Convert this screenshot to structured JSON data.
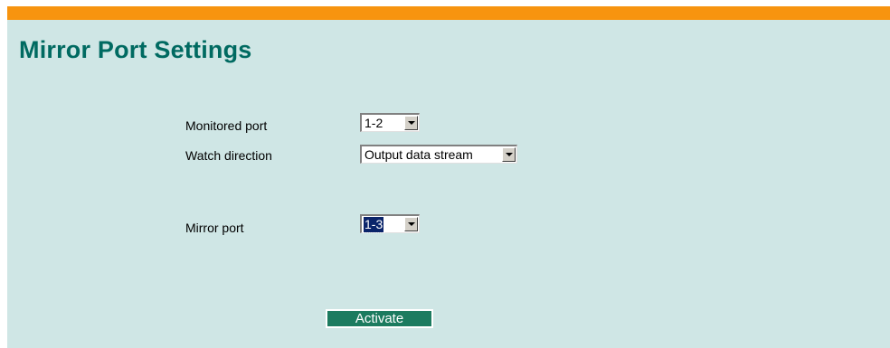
{
  "header": {
    "title": "Mirror Port Settings",
    "bar_color": "#f7940f",
    "title_color": "#006a61"
  },
  "form": {
    "monitored_port": {
      "label": "Monitored port",
      "value": "1-2"
    },
    "watch_direction": {
      "label": "Watch direction",
      "value": "Output data stream"
    },
    "mirror_port": {
      "label": "Mirror port",
      "value": "1-3"
    }
  },
  "actions": {
    "activate_label": "Activate",
    "activate_color": "#1c7b5f"
  },
  "background_color": "#cfe6e5"
}
